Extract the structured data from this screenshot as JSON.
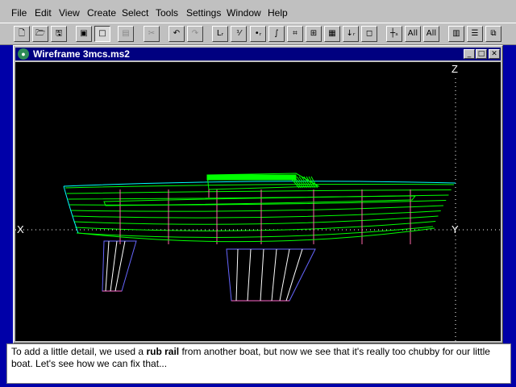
{
  "menu": [
    "File",
    "Edit",
    "View",
    "Create",
    "Select",
    "Tools",
    "Settings",
    "Window",
    "Help"
  ],
  "toolbar": [
    {
      "icon": "new-document-icon",
      "glyph": "🗋"
    },
    {
      "icon": "open-folder-icon",
      "glyph": "🗁"
    },
    {
      "icon": "save-icon",
      "glyph": "🖫"
    },
    {
      "icon": "view-frame-icon",
      "glyph": "▣"
    },
    {
      "icon": "view-window-icon",
      "glyph": "□",
      "pressed": true
    },
    {
      "icon": "table-icon",
      "glyph": "▤",
      "disabled": true
    },
    {
      "icon": "cut-icon",
      "glyph": "✂",
      "disabled": true
    },
    {
      "icon": "undo-icon",
      "glyph": "↶"
    },
    {
      "icon": "redo-icon",
      "glyph": "↷",
      "disabled": true
    },
    {
      "icon": "line-icon",
      "glyph": "Lᵣ"
    },
    {
      "icon": "fraction-icon",
      "glyph": "⅟"
    },
    {
      "icon": "point-icon",
      "glyph": "•ᵣ"
    },
    {
      "icon": "curve-icon",
      "glyph": "∫"
    },
    {
      "icon": "surface-icon",
      "glyph": "⌗"
    },
    {
      "icon": "grid-icon",
      "glyph": "⊞"
    },
    {
      "icon": "mesh-icon",
      "glyph": "▦"
    },
    {
      "icon": "arrow-down-icon",
      "glyph": "↓ᵣ"
    },
    {
      "icon": "box-icon",
      "glyph": "◻"
    },
    {
      "icon": "measure-icon",
      "glyph": "┼ₛ"
    },
    {
      "icon": "all-plus-icon",
      "glyph": "All"
    },
    {
      "icon": "all-minus-icon",
      "glyph": "All"
    },
    {
      "icon": "tile-vertical-icon",
      "glyph": "▥"
    },
    {
      "icon": "tile-horizontal-icon",
      "glyph": "☰"
    },
    {
      "icon": "cascade-icon",
      "glyph": "⧉"
    }
  ],
  "window": {
    "title": "Wireframe 3mcs.ms2",
    "minimize": "_",
    "maximize": "□",
    "close": "✕"
  },
  "axes": {
    "x": "X",
    "y": "Y",
    "z": "Z"
  },
  "colors": {
    "hull_lines": "#00ff00",
    "stations": "#ff66aa",
    "deck": "#00ffff",
    "keel": "#6666ff",
    "cabin": "#00ff00"
  },
  "caption": {
    "pre": "To add a little detail, we used a ",
    "bold": "rub rail",
    "post": " from another boat, but now we see that it's really too chubby for our little boat. Let's see how we can fix that..."
  }
}
